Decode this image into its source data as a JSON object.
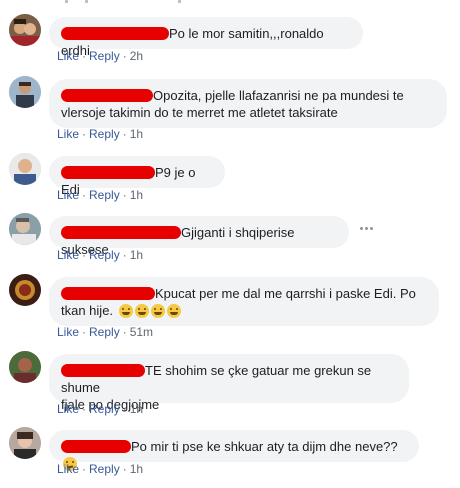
{
  "comments": [
    {
      "text": "Po le mor samitin,,,ronaldo erdhi",
      "like": "Like",
      "reply": "Reply",
      "time": "2h"
    },
    {
      "line1": "Opozita, pjelle llafazanrisi ne pa mundesi te",
      "line2": "vlersoje takimin do te merret me atletet taksirate",
      "like": "Like",
      "reply": "Reply",
      "time": "1h"
    },
    {
      "text": "P9 je o Edi",
      "like": "Like",
      "reply": "Reply",
      "time": "1h"
    },
    {
      "text": "Gjiganti i shqiperise suksese",
      "like": "Like",
      "reply": "Reply",
      "time": "1h"
    },
    {
      "line1": "Kpucat per me dal me qarrshi i paske Edi. Po",
      "line2": "tkan hije.",
      "like": "Like",
      "reply": "Reply",
      "time": "51m"
    },
    {
      "line1": "TE shohim se çke gatuar me grekun se shume",
      "line2": "fjale po degjojme",
      "like": "Like",
      "reply": "Reply",
      "time": "1h"
    },
    {
      "text": "Po mir ti pse ke shkuar aty ta dijm dhe neve??",
      "like": "Like",
      "reply": "Reply",
      "time": "1h"
    }
  ],
  "colors": {
    "link": "#385898",
    "bubble": "#f2f3f5",
    "redaction": "#e60000",
    "meta": "#606770"
  },
  "icons": [
    "avatar",
    "laughing-emoji",
    "confused-emoji",
    "more-options-icon"
  ]
}
